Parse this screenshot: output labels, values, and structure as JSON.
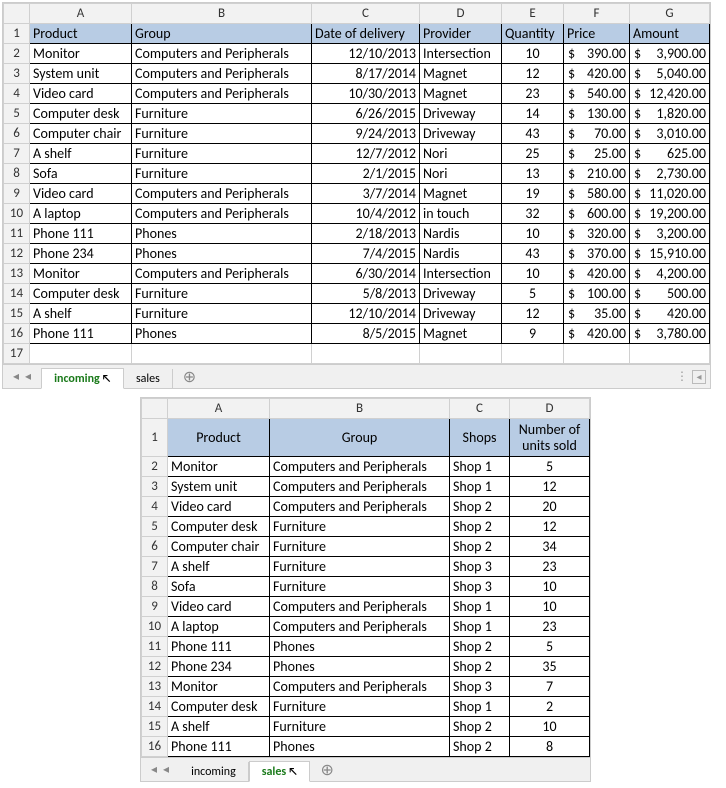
{
  "sheets_top": {
    "columns": [
      "A",
      "B",
      "C",
      "D",
      "E",
      "F",
      "G"
    ],
    "headers": [
      "Product",
      "Group",
      "Date of delivery",
      "Provider",
      "Quantity",
      "Price",
      "Amount"
    ],
    "rows": [
      {
        "product": "Monitor",
        "group": "Computers and Peripherals",
        "date": "12/10/2013",
        "provider": "Intersection",
        "qty": "10",
        "price": "390.00",
        "amount": "3,900.00"
      },
      {
        "product": "System unit",
        "group": "Computers and Peripherals",
        "date": "8/17/2014",
        "provider": "Magnet",
        "qty": "12",
        "price": "420.00",
        "amount": "5,040.00"
      },
      {
        "product": "Video card",
        "group": "Computers and Peripherals",
        "date": "10/30/2013",
        "provider": "Magnet",
        "qty": "23",
        "price": "540.00",
        "amount": "12,420.00"
      },
      {
        "product": "Computer desk",
        "group": "Furniture",
        "date": "6/26/2015",
        "provider": "Driveway",
        "qty": "14",
        "price": "130.00",
        "amount": "1,820.00"
      },
      {
        "product": "Computer chair",
        "group": "Furniture",
        "date": "9/24/2013",
        "provider": "Driveway",
        "qty": "43",
        "price": "70.00",
        "amount": "3,010.00"
      },
      {
        "product": "A shelf",
        "group": "Furniture",
        "date": "12/7/2012",
        "provider": "Nori",
        "qty": "25",
        "price": "25.00",
        "amount": "625.00"
      },
      {
        "product": "Sofa",
        "group": "Furniture",
        "date": "2/1/2015",
        "provider": "Nori",
        "qty": "13",
        "price": "210.00",
        "amount": "2,730.00"
      },
      {
        "product": "Video card",
        "group": "Computers and Peripherals",
        "date": "3/7/2014",
        "provider": "Magnet",
        "qty": "19",
        "price": "580.00",
        "amount": "11,020.00"
      },
      {
        "product": "A laptop",
        "group": "Computers and Peripherals",
        "date": "10/4/2012",
        "provider": "in touch",
        "qty": "32",
        "price": "600.00",
        "amount": "19,200.00"
      },
      {
        "product": "Phone 111",
        "group": "Phones",
        "date": "2/18/2013",
        "provider": "Nardis",
        "qty": "10",
        "price": "320.00",
        "amount": "3,200.00"
      },
      {
        "product": "Phone 234",
        "group": "Phones",
        "date": "7/4/2015",
        "provider": "Nardis",
        "qty": "43",
        "price": "370.00",
        "amount": "15,910.00"
      },
      {
        "product": "Monitor",
        "group": "Computers and Peripherals",
        "date": "6/30/2014",
        "provider": "Intersection",
        "qty": "10",
        "price": "420.00",
        "amount": "4,200.00"
      },
      {
        "product": "Computer desk",
        "group": "Furniture",
        "date": "5/8/2013",
        "provider": "Driveway",
        "qty": "5",
        "price": "100.00",
        "amount": "500.00"
      },
      {
        "product": "A shelf",
        "group": "Furniture",
        "date": "12/10/2014",
        "provider": "Driveway",
        "qty": "12",
        "price": "35.00",
        "amount": "420.00"
      },
      {
        "product": "Phone 111",
        "group": "Phones",
        "date": "8/5/2015",
        "provider": "Magnet",
        "qty": "9",
        "price": "420.00",
        "amount": "3,780.00"
      }
    ],
    "tabs": {
      "active": "incoming",
      "other": "sales",
      "add": "+"
    }
  },
  "sheets_bottom": {
    "columns": [
      "A",
      "B",
      "C",
      "D"
    ],
    "headers": [
      "Product",
      "Group",
      "Shops",
      "Number of units sold"
    ],
    "rows": [
      {
        "product": "Monitor",
        "group": "Computers and Peripherals",
        "shop": "Shop 1",
        "units": "5"
      },
      {
        "product": "System unit",
        "group": "Computers and Peripherals",
        "shop": "Shop 1",
        "units": "12"
      },
      {
        "product": "Video card",
        "group": "Computers and Peripherals",
        "shop": "Shop 2",
        "units": "20"
      },
      {
        "product": "Computer desk",
        "group": "Furniture",
        "shop": "Shop 2",
        "units": "12"
      },
      {
        "product": "Computer chair",
        "group": "Furniture",
        "shop": "Shop 2",
        "units": "34"
      },
      {
        "product": "A shelf",
        "group": "Furniture",
        "shop": "Shop 3",
        "units": "23"
      },
      {
        "product": "Sofa",
        "group": "Furniture",
        "shop": "Shop 3",
        "units": "10"
      },
      {
        "product": "Video card",
        "group": "Computers and Peripherals",
        "shop": "Shop 1",
        "units": "10"
      },
      {
        "product": "A laptop",
        "group": "Computers and Peripherals",
        "shop": "Shop 1",
        "units": "23"
      },
      {
        "product": "Phone 111",
        "group": "Phones",
        "shop": "Shop 2",
        "units": "5"
      },
      {
        "product": "Phone 234",
        "group": "Phones",
        "shop": "Shop 2",
        "units": "35"
      },
      {
        "product": "Monitor",
        "group": "Computers and Peripherals",
        "shop": "Shop 3",
        "units": "7"
      },
      {
        "product": "Computer desk",
        "group": "Furniture",
        "shop": "Shop 1",
        "units": "2"
      },
      {
        "product": "A shelf",
        "group": "Furniture",
        "shop": "Shop 2",
        "units": "10"
      },
      {
        "product": "Phone 111",
        "group": "Phones",
        "shop": "Shop 2",
        "units": "8"
      }
    ],
    "tabs": {
      "active": "sales",
      "other": "incoming",
      "add": "+"
    }
  },
  "nav_icons": {
    "first": "◂",
    "prev": "◂",
    "next": "▸",
    "last": "▸",
    "dots": "⋮"
  }
}
